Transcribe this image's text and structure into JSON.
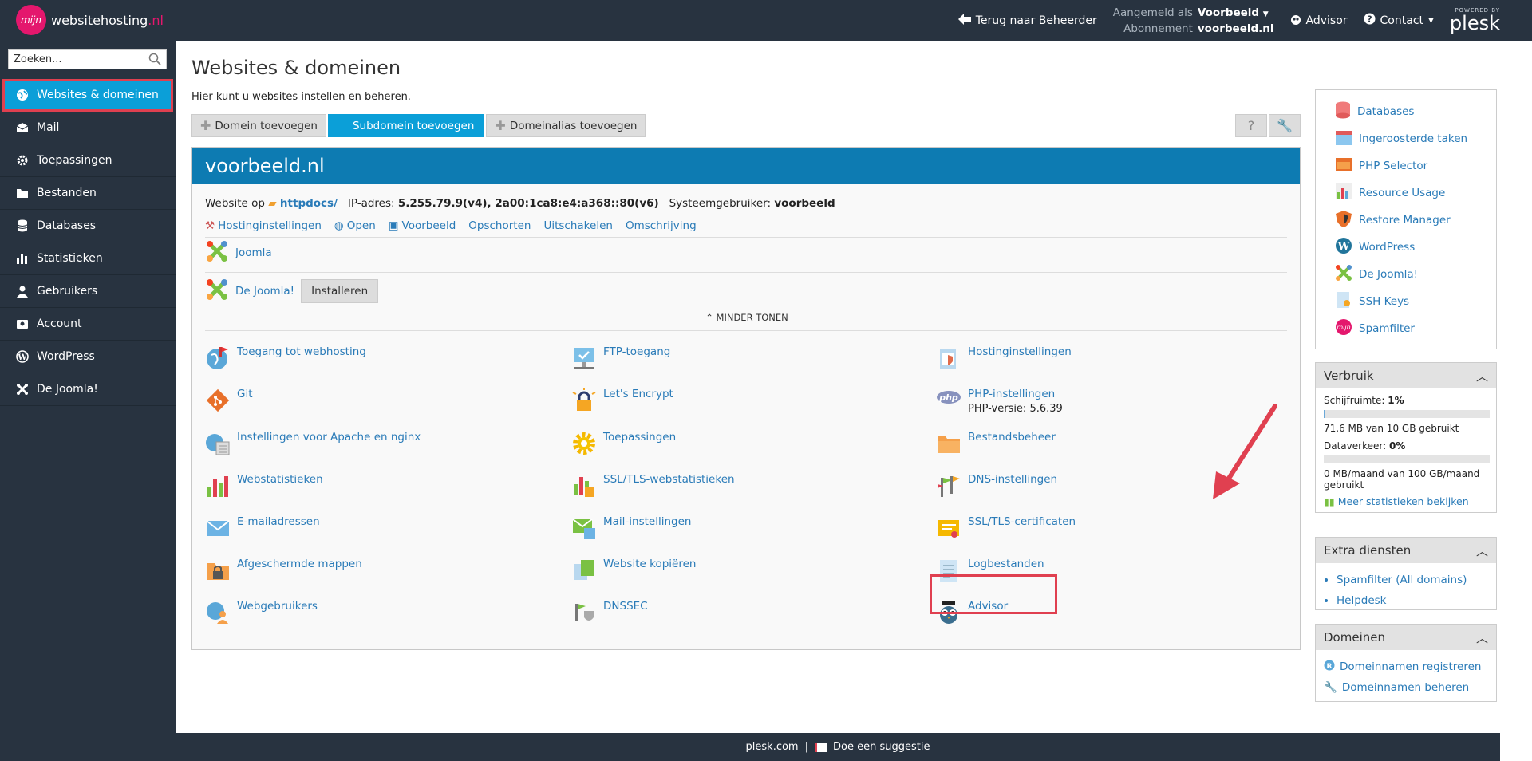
{
  "brand": {
    "badge": "mijn",
    "name": "websitehosting",
    "tld": ".nl"
  },
  "topbar": {
    "back": "Terug naar Beheerder",
    "logged_as_label": "Aangemeld als",
    "logged_as": "Voorbeeld",
    "subscription_label": "Abonnement",
    "subscription": "voorbeeld.nl",
    "advisor": "Advisor",
    "contact": "Contact",
    "powered": "POWERED BY",
    "plesk": "plesk"
  },
  "sidebar": {
    "search_placeholder": "Zoeken...",
    "items": [
      {
        "label": "Websites & domeinen",
        "icon": "globe-icon"
      },
      {
        "label": "Mail",
        "icon": "mail-icon"
      },
      {
        "label": "Toepassingen",
        "icon": "gear-icon"
      },
      {
        "label": "Bestanden",
        "icon": "folder-icon"
      },
      {
        "label": "Databases",
        "icon": "database-icon"
      },
      {
        "label": "Statistieken",
        "icon": "bar-chart-icon"
      },
      {
        "label": "Gebruikers",
        "icon": "user-icon"
      },
      {
        "label": "Account",
        "icon": "account-icon"
      },
      {
        "label": "WordPress",
        "icon": "wordpress-icon"
      },
      {
        "label": "De Joomla!",
        "icon": "joomla-icon"
      }
    ]
  },
  "main": {
    "title": "Websites & domeinen",
    "intro": "Hier kunt u websites instellen en beheren.",
    "toolbar": [
      "Domein toevoegen",
      "Subdomein toevoegen",
      "Domeinalias toevoegen"
    ]
  },
  "domain": {
    "name": "voorbeeld.nl",
    "website_on": "Website op",
    "docroot": "httpdocs/",
    "ip_label": "IP-adres:",
    "ip": "5.255.79.9(v4), 2a00:1ca8:e4:a368::80(v6)",
    "sysuser_label": "Systeemgebruiker:",
    "sysuser": "voorbeeld",
    "links": [
      "Hostinginstellingen",
      "Open",
      "Voorbeeld",
      "Opschorten",
      "Uitschakelen",
      "Omschrijving"
    ],
    "app1": "Joomla",
    "app2": "De Joomla!",
    "install": "Installeren",
    "less": "MINDER TONEN",
    "features": [
      [
        "Toegang tot webhosting",
        "FTP-toegang",
        "Hostinginstellingen"
      ],
      [
        "Git",
        "Let's Encrypt",
        "PHP-instellingen"
      ],
      [
        "Instellingen voor Apache en nginx",
        "Toepassingen",
        "Bestandsbeheer"
      ],
      [
        "Webstatistieken",
        "SSL/TLS-webstatistieken",
        "DNS-instellingen"
      ],
      [
        "E-mailadressen",
        "Mail-instellingen",
        "SSL/TLS-certificaten"
      ],
      [
        "Afgeschermde mappen",
        "Website kopiëren",
        "Logbestanden"
      ],
      [
        "Webgebruikers",
        "DNSSEC",
        "Advisor"
      ]
    ],
    "php_version": "PHP-versie: 5.6.39"
  },
  "tools": [
    "Databases",
    "Ingeroosterde taken",
    "PHP Selector",
    "Resource Usage",
    "Restore Manager",
    "WordPress",
    "De Joomla!",
    "SSH Keys",
    "Spamfilter"
  ],
  "usage": {
    "title": "Verbruik",
    "disk_label": "Schijfruimte:",
    "disk_pct": "1%",
    "disk_text": "71.6 MB van 10 GB gebruikt",
    "disk_fill": 0.01,
    "traffic_label": "Dataverkeer:",
    "traffic_pct": "0%",
    "traffic_text": "0 MB/maand van 100 GB/maand gebruikt",
    "traffic_fill": 0,
    "more": "Meer statistieken bekijken"
  },
  "extra": {
    "title": "Extra diensten",
    "items": [
      "Spamfilter (All domains)",
      "Helpdesk"
    ]
  },
  "domains": {
    "title": "Domeinen",
    "items": [
      "Domeinnamen registreren",
      "Domeinnamen beheren"
    ]
  },
  "footer": {
    "site": "plesk.com",
    "sep": "|",
    "suggest": "Doe een suggestie"
  }
}
